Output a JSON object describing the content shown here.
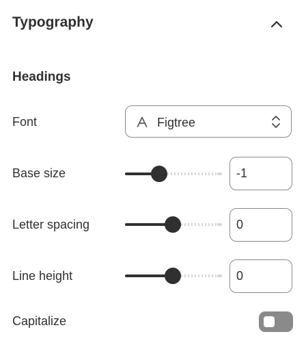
{
  "section": {
    "title": "Typography",
    "collapse_icon": "chevron-up-icon"
  },
  "headings": {
    "title": "Headings",
    "font": {
      "label": "Font",
      "value": "Figtree",
      "icon": "font-letter-a-icon",
      "select_icon": "chevron-up-down-icon"
    },
    "base_size": {
      "label": "Base size",
      "value": "-1",
      "slider_fraction": 0.35
    },
    "letter_spacing": {
      "label": "Letter spacing",
      "value": "0",
      "slider_fraction": 0.49
    },
    "line_height": {
      "label": "Line height",
      "value": "0",
      "slider_fraction": 0.49
    },
    "capitalize": {
      "label": "Capitalize",
      "enabled": false
    }
  },
  "colors": {
    "text": "#303030",
    "border": "#8a8a8a",
    "track_active": "#303030",
    "track_inactive": "#d6d6d6",
    "toggle_off": "#8a8a8a"
  }
}
